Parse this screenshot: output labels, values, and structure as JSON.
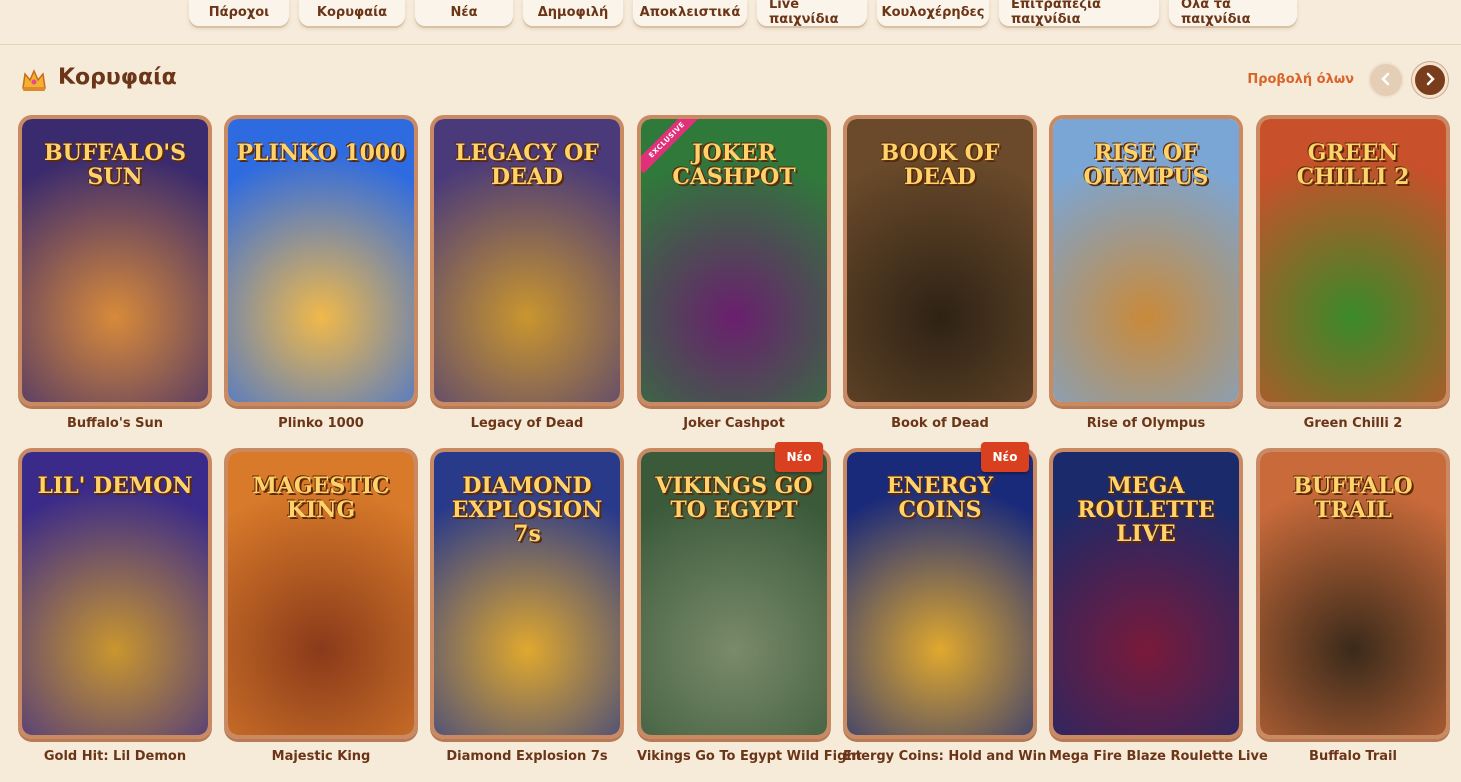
{
  "tabs": [
    "Πάροχοι",
    "Κορυφαία",
    "Νέα",
    "Δημοφιλή",
    "Αποκλειστικά",
    "Live παιχνίδια",
    "Κουλοχέρηδες",
    "Επιτραπέζια παιχνίδια",
    "Ολα τα παιχνίδια"
  ],
  "section": {
    "title": "Κορυφαία",
    "view_all": "Προβολή όλων",
    "icon": "crown-icon"
  },
  "badges": {
    "new": "Νέο",
    "exclusive": "EXCLUSIVE"
  },
  "games": [
    {
      "name": "Buffalo's Sun",
      "art_title": "BUFFALO'S SUN",
      "colors": [
        "#3a2a6e",
        "#d88a3a"
      ],
      "badge": ""
    },
    {
      "name": "Plinko 1000",
      "art_title": "PLINKO 1000",
      "colors": [
        "#2f6be0",
        "#f0b94a"
      ],
      "badge": ""
    },
    {
      "name": "Legacy of Dead",
      "art_title": "LEGACY OF DEAD",
      "colors": [
        "#4a3a7a",
        "#c9962e"
      ],
      "badge": ""
    },
    {
      "name": "Joker Cashpot",
      "art_title": "JOKER CASHPOT",
      "colors": [
        "#2f7a3a",
        "#6a1f6e"
      ],
      "badge": "exclusive"
    },
    {
      "name": "Book of Dead",
      "art_title": "BOOK OF DEAD",
      "colors": [
        "#6a4a2a",
        "#2e2215"
      ],
      "badge": ""
    },
    {
      "name": "Rise of Olympus",
      "art_title": "RISE OF OLYMPUS",
      "colors": [
        "#7aa6d6",
        "#c98a3a"
      ],
      "badge": ""
    },
    {
      "name": "Green Chilli 2",
      "art_title": "GREEN CHILLI 2",
      "colors": [
        "#c8502a",
        "#3a8a2a"
      ],
      "badge": ""
    },
    {
      "name": "Gold Hit: Lil Demon",
      "art_title": "LIL' DEMON",
      "colors": [
        "#3a2a8a",
        "#c9962e"
      ],
      "badge": ""
    },
    {
      "name": "Majestic King",
      "art_title": "MAGESTIC KING",
      "colors": [
        "#d87a2a",
        "#8a3a1a"
      ],
      "badge": ""
    },
    {
      "name": "Diamond Explosion 7s",
      "art_title": "DIAMOND EXPLOSION 7s",
      "colors": [
        "#2a3a8a",
        "#e0a82e"
      ],
      "badge": ""
    },
    {
      "name": "Vikings Go To Egypt Wild Fight",
      "art_title": "VIKINGS GO TO EGYPT",
      "colors": [
        "#3a5a3a",
        "#7a8a6a"
      ],
      "badge": "new"
    },
    {
      "name": "Energy Coins: Hold and Win",
      "art_title": "ENERGY COINS",
      "colors": [
        "#1a2a7a",
        "#e0a82e"
      ],
      "badge": "new"
    },
    {
      "name": "Mega Fire Blaze Roulette Live",
      "art_title": "MEGA ROULETTE LIVE",
      "colors": [
        "#1a2a6a",
        "#7a1a3a"
      ],
      "badge": ""
    },
    {
      "name": "Buffalo Trail",
      "art_title": "BUFFALO TRAIL",
      "colors": [
        "#c86a3a",
        "#3a2a1a"
      ],
      "badge": ""
    }
  ]
}
